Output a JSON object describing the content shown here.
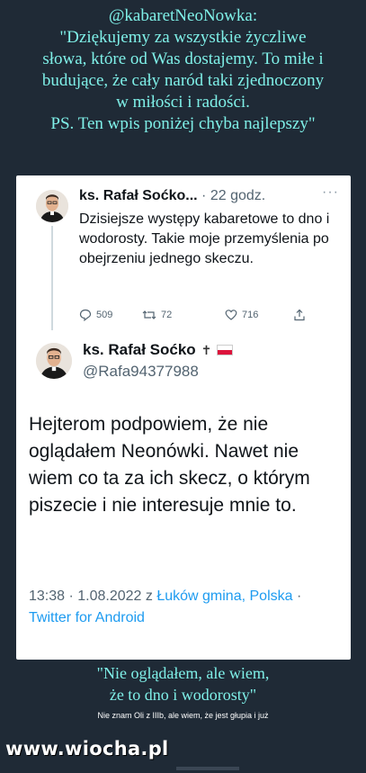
{
  "top_caption": {
    "lines": [
      "@kabaretNeoNowka:",
      "\"Dziękujemy za wszystkie życzliwe",
      "słowa, które od Was dostajemy. To miłe i",
      "budujące, że cały naród taki zjednoczony",
      "w miłości i radości.",
      "PS. Ten wpis poniżej chyba najlepszy\""
    ]
  },
  "tweet1": {
    "name": "ks. Rafał Soćko...",
    "separator": " · ",
    "time": "22 godz.",
    "more": "···",
    "text": "Dzisiejsze występy kabaretowe to dno i wodorosty. Takie moje przemyślenia po obejrzeniu jednego skeczu.",
    "replies": "509",
    "retweets": "72",
    "likes": "716"
  },
  "tweet2": {
    "name": "ks. Rafał Soćko",
    "handle": "@Rafa94377988",
    "text": "Hejterom podpowiem, że nie oglądałem Neonówki. Nawet nie wiem co ta za ich skecz, o którym piszecie i nie interesuje mnie to.",
    "time": "13:38 · 1.08.2022",
    "from_prefix": " z ",
    "location": "Łuków gmina, Polska",
    "dot": " · ",
    "client": "Twitter for Android"
  },
  "bottom_caption": {
    "lines": [
      "\"Nie oglądałem, ale wiem,",
      "że to dno i wodorosty\""
    ],
    "subtext": "Nie znam Oli z IIIb, ale wiem, że jest głupia i już"
  },
  "watermark": "www.wiocha.pl",
  "colors": {
    "background": "#1f2a36",
    "caption": "#7ff0e8",
    "link": "#1d9bf0"
  }
}
